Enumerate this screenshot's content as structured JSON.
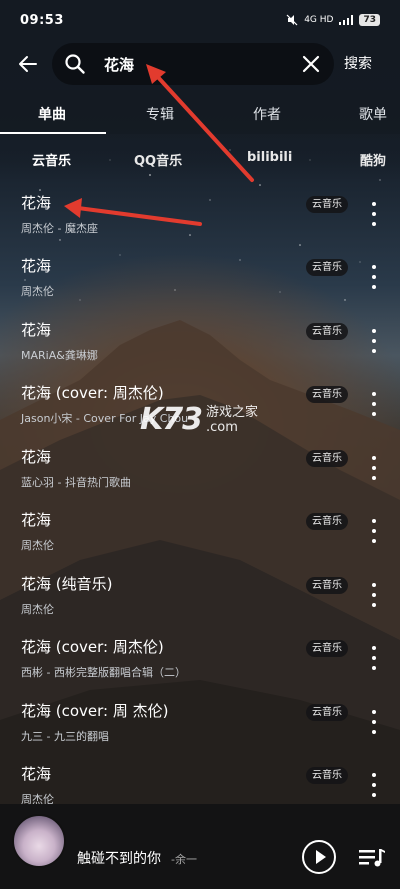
{
  "status_bar": {
    "time": "09:53",
    "network": "4G HD",
    "battery": "73"
  },
  "search": {
    "value": "花海",
    "submit_label": "搜索"
  },
  "tabs": [
    {
      "label": "单曲"
    },
    {
      "label": "专辑"
    },
    {
      "label": "作者"
    },
    {
      "label": "歌单"
    }
  ],
  "sources": [
    {
      "label": "云音乐"
    },
    {
      "label": "QQ音乐"
    },
    {
      "label": "bilibili"
    },
    {
      "label": "酷狗"
    }
  ],
  "songs": [
    {
      "title": "花海",
      "subtitle": "周杰伦 - 魔杰座",
      "badge": "云音乐"
    },
    {
      "title": "花海",
      "subtitle": "周杰伦",
      "badge": "云音乐"
    },
    {
      "title": "花海",
      "subtitle": "MARiA&龚琳娜",
      "badge": "云音乐"
    },
    {
      "title": "花海 (cover: 周杰伦)",
      "subtitle": "Jason小宋 - Cover For Jay Chou",
      "badge": "云音乐"
    },
    {
      "title": "花海",
      "subtitle": "蓝心羽 - 抖音热门歌曲",
      "badge": "云音乐"
    },
    {
      "title": "花海",
      "subtitle": "周杰伦",
      "badge": "云音乐"
    },
    {
      "title": "花海 (纯音乐)",
      "subtitle": "周杰伦",
      "badge": "云音乐"
    },
    {
      "title": "花海 (cover: 周杰伦)",
      "subtitle": "西彬 - 西彬完整版翻唱合辑（二）",
      "badge": "云音乐"
    },
    {
      "title": "花海 (cover: 周 杰伦)",
      "subtitle": "九三 - 九三的翻唱",
      "badge": "云音乐"
    },
    {
      "title": "花海",
      "subtitle": "周杰伦",
      "badge": "云音乐"
    }
  ],
  "player": {
    "title": "触碰不到的你",
    "artist": "-余一"
  },
  "watermark": {
    "logo": "K73",
    "text": "游戏之家",
    "domain": ".com"
  },
  "icons": {
    "back": "arrow-left-icon",
    "search": "magnifier-icon",
    "clear": "close-icon",
    "more": "more-vertical-icon",
    "play": "play-icon",
    "playlist": "playlist-icon"
  },
  "colors": {
    "arrow": "#e23b2e",
    "badge_bg": "#141416"
  }
}
